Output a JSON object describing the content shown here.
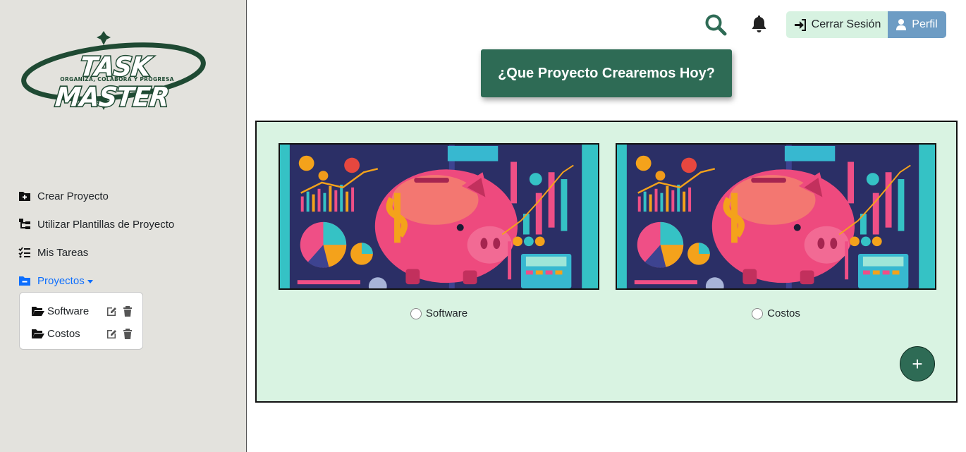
{
  "brand": {
    "logo_text": "TASK MASTER",
    "logo_tagline": "ORGANIZA, COLABORA Y PROGRESA"
  },
  "sidebar": {
    "items": [
      {
        "label": "Crear Proyecto",
        "icon": "folder-plus-icon"
      },
      {
        "label": "Utilizar Plantillas de Proyecto",
        "icon": "sitemap-icon"
      },
      {
        "label": "Mis Tareas",
        "icon": "list-check-icon"
      },
      {
        "label": "Proyectos",
        "icon": "folder-minus-icon",
        "active": true
      }
    ],
    "projects": [
      {
        "label": "Software"
      },
      {
        "label": "Costos"
      }
    ]
  },
  "header": {
    "logout_label": "Cerrar Sesión",
    "profile_label": "Perfil"
  },
  "main": {
    "title": "¿Que Proyecto Crearemos Hoy?",
    "projects": [
      {
        "label": "Software",
        "image": "piggy-bank-finance-illustration"
      },
      {
        "label": "Costos",
        "image": "piggy-bank-finance-illustration"
      }
    ],
    "add_label": "+"
  },
  "colors": {
    "sidebar_bg": "#e3e2dd",
    "accent_green": "#2e6b55",
    "panel_bg": "#d9f3e2",
    "link_blue": "#0d6efd",
    "profile_blue": "#6d9cc4"
  }
}
